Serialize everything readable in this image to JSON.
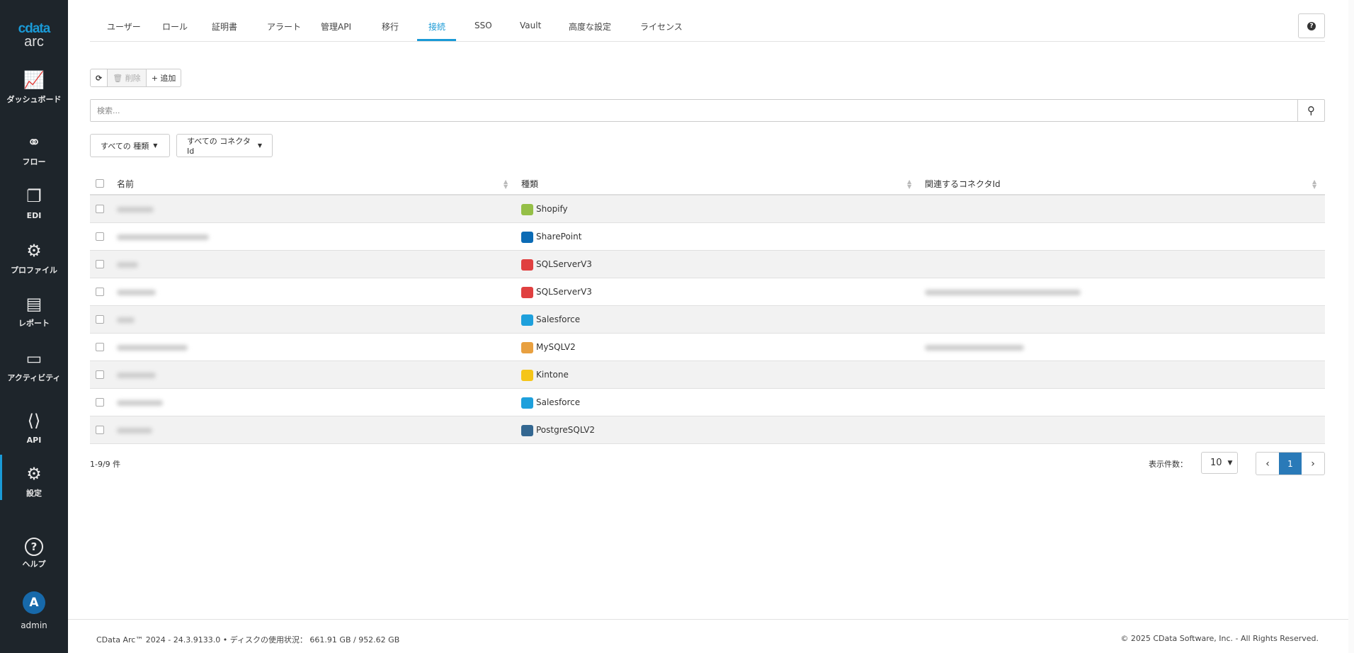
{
  "logo": {
    "brand": "cdata",
    "product": "arc"
  },
  "sidebar": [
    {
      "label": "ダッシュボード",
      "icon": "chart-line-icon"
    },
    {
      "label": "フロー",
      "icon": "flow-icon"
    },
    {
      "label": "EDI",
      "icon": "copy-icon"
    },
    {
      "label": "プロファイル",
      "icon": "gears-icon"
    },
    {
      "label": "レポート",
      "icon": "document-icon"
    },
    {
      "label": "アクティビティ",
      "icon": "stack-icon"
    },
    {
      "label": "API",
      "icon": "code-file-icon"
    },
    {
      "label": "設定",
      "icon": "gear-icon",
      "active": true
    },
    {
      "label": "ヘルプ",
      "icon": "help-icon"
    }
  ],
  "user": {
    "initial": "A",
    "name": "admin"
  },
  "tabs": [
    "ユーザー",
    "ロール",
    "証明書",
    "アラート",
    "管理API",
    "移行",
    "接続",
    "SSO",
    "Vault",
    "高度な設定",
    "ライセンス"
  ],
  "active_tab": "接続",
  "toolbar": {
    "delete": "削除",
    "add": "+ 追加"
  },
  "search": {
    "placeholder": "検索..."
  },
  "filters": {
    "type": "すべての 種類",
    "connector": "すべての コネクタId"
  },
  "table": {
    "headers": {
      "name": "名前",
      "type": "種類",
      "related": "関連するコネクタId"
    },
    "rows": [
      {
        "type": "Shopify",
        "icon": "#95bf47"
      },
      {
        "type": "SharePoint",
        "icon": "#0b6bb5"
      },
      {
        "type": "SQLServerV3",
        "icon": "#e04040"
      },
      {
        "type": "SQLServerV3",
        "icon": "#e04040",
        "related": true
      },
      {
        "type": "Salesforce",
        "icon": "#1ea0dc"
      },
      {
        "type": "MySQLV2",
        "icon": "#e8a040",
        "related": true
      },
      {
        "type": "Kintone",
        "icon": "#f5c518"
      },
      {
        "type": "Salesforce",
        "icon": "#1ea0dc"
      },
      {
        "type": "PostgreSQLV2",
        "icon": "#336791"
      }
    ]
  },
  "pagination": {
    "count": "1-9/9 件",
    "page_size_label": "表示件数：",
    "page_size": "10",
    "current_page": "1"
  },
  "footer": {
    "left": "CData Arc™ 2024 - 24.3.9133.0  •  ディスクの使用状況： 661.91 GB / 952.62 GB",
    "right": "© 2025 CData Software, Inc. - All Rights Reserved."
  }
}
